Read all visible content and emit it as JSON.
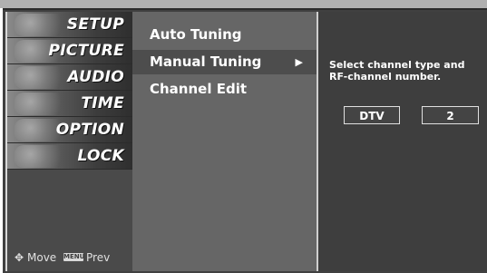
{
  "sidebar": {
    "items": [
      {
        "label": "SETUP"
      },
      {
        "label": "PICTURE"
      },
      {
        "label": "AUDIO"
      },
      {
        "label": "TIME"
      },
      {
        "label": "OPTION"
      },
      {
        "label": "LOCK"
      }
    ],
    "footer": {
      "move_label": "Move",
      "menu_key": "MENU",
      "prev_label": "Prev"
    }
  },
  "submenu": {
    "items": [
      {
        "label": "Auto Tuning"
      },
      {
        "label": "Manual Tuning",
        "selected": true
      },
      {
        "label": "Channel Edit"
      }
    ],
    "arrow": "▶"
  },
  "detail": {
    "description": "Select channel type and RF-channel number.",
    "channel_type": "DTV",
    "channel_number": "2"
  },
  "colors": {
    "background": "#404040",
    "text": "#ffffff"
  }
}
